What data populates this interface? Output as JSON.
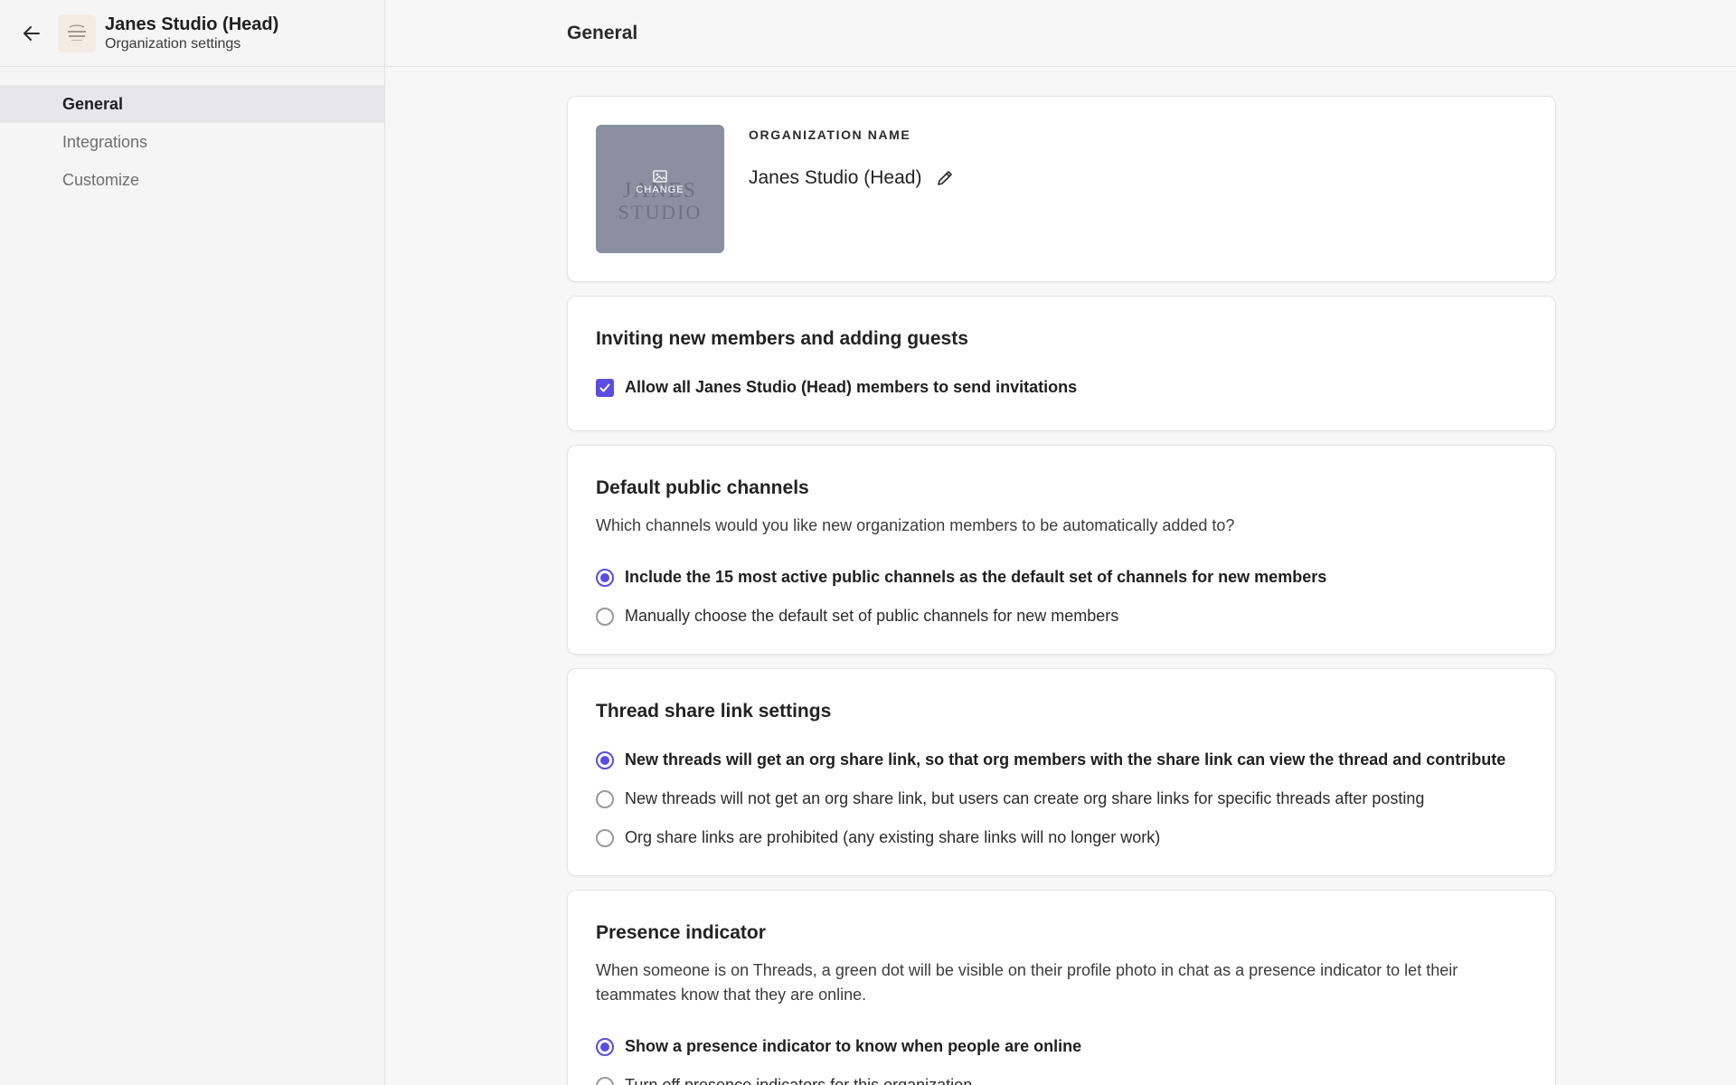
{
  "sidebar": {
    "org_name": "Janes Studio (Head)",
    "subtitle": "Organization settings",
    "nav": [
      {
        "label": "General",
        "active": true
      },
      {
        "label": "Integrations",
        "active": false
      },
      {
        "label": "Customize",
        "active": false
      }
    ]
  },
  "header": {
    "title": "General"
  },
  "org_card": {
    "section_label": "ORGANIZATION NAME",
    "name": "Janes Studio (Head)",
    "change_label": "CHANGE",
    "logo_text_line1": "JANES",
    "logo_text_line2": "STUDIO"
  },
  "invites": {
    "title": "Inviting new members and adding guests",
    "checkbox_label": "Allow all Janes Studio (Head) members to send invitations",
    "checked": true
  },
  "channels": {
    "title": "Default public channels",
    "description": "Which channels would you like new organization members to be automatically added to?",
    "options": [
      "Include the 15 most active public channels as the default set of channels for new members",
      "Manually choose the default set of public channels for new members"
    ],
    "selected": 0
  },
  "share_links": {
    "title": "Thread share link settings",
    "options": [
      "New threads will get an org share link, so that org members with the share link can view the thread and contribute",
      "New threads will not get an org share link, but users can create org share links for specific threads after posting",
      "Org share links are prohibited (any existing share links will no longer work)"
    ],
    "selected": 0
  },
  "presence": {
    "title": "Presence indicator",
    "description": "When someone is on Threads, a green dot will be visible on their profile photo in chat as a presence indicator to let their teammates know that they are online.",
    "options": [
      "Show a presence indicator to know when people are online",
      "Turn off presence indicators for this organization"
    ],
    "selected": 0
  },
  "colors": {
    "accent": "#5b4de0",
    "sidebar_bg": "#f5f5f5",
    "nav_active_bg": "#e7e7e9"
  }
}
